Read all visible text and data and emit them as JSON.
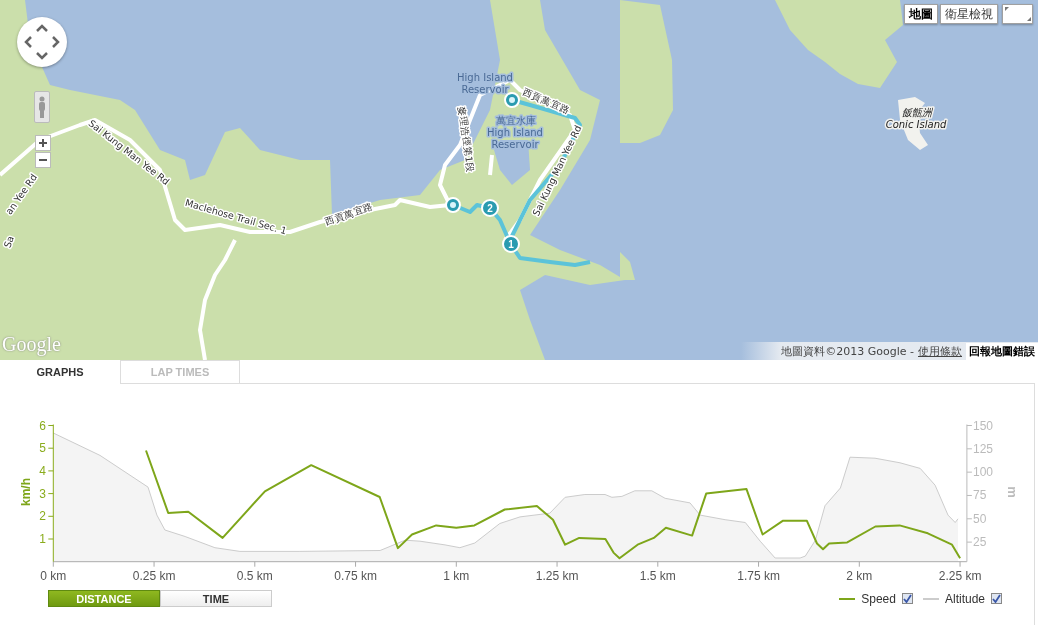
{
  "map": {
    "labels": [
      {
        "text": "High Island",
        "kind": "water"
      },
      {
        "text": "Reservoir",
        "kind": "water"
      },
      {
        "text": "萬宜水庫",
        "kind": "water"
      },
      {
        "text": "High Island",
        "kind": "water"
      },
      {
        "text": "Reservoir",
        "kind": "water"
      },
      {
        "text": "西貢萬宜路",
        "kind": "road"
      },
      {
        "text": "Sai Kung Man Yee Rd",
        "kind": "road"
      },
      {
        "text": "麥理浩徑第1段",
        "kind": "road"
      },
      {
        "text": "Sai Kung Man Yee Rd",
        "kind": "road"
      },
      {
        "text": "Maclehose Trail Sec. 1",
        "kind": "road"
      },
      {
        "text": "西貢萬宜路",
        "kind": "road"
      },
      {
        "text": "an Yee Rd",
        "kind": "road"
      },
      {
        "text": "Sa",
        "kind": "road"
      },
      {
        "text": "飯甑洲",
        "kind": "island"
      },
      {
        "text": "Conic Island",
        "kind": "island"
      }
    ],
    "markers": [
      {
        "kind": "dot"
      },
      {
        "kind": "dot"
      },
      {
        "kind": "number",
        "label": "2"
      },
      {
        "kind": "number",
        "label": "1"
      }
    ],
    "map_type_buttons": [
      {
        "label": "地圖",
        "selected": true
      },
      {
        "label": "衛星檢視",
        "selected": false
      }
    ],
    "logo": "Google",
    "attribution": {
      "text": "地圖資料©2013 Google -",
      "terms_link": "使用條款",
      "report_link": "回報地圖錯誤"
    }
  },
  "tabs": [
    {
      "label": "GRAPHS",
      "selected": true
    },
    {
      "label": "LAP TIMES",
      "selected": false
    }
  ],
  "chart_data": {
    "type": "line",
    "ylabel": "km/h",
    "y2label": "m",
    "xlim": [
      0,
      2.267
    ],
    "ylim": [
      0,
      6
    ],
    "y2lim": [
      4,
      150
    ],
    "xticks": [
      {
        "value": 0,
        "label": "0 km"
      },
      {
        "value": 0.25,
        "label": "0.25 km"
      },
      {
        "value": 0.5,
        "label": "0.5 km"
      },
      {
        "value": 0.75,
        "label": "0.75 km"
      },
      {
        "value": 1,
        "label": "1 km"
      },
      {
        "value": 1.25,
        "label": "1.25 km"
      },
      {
        "value": 1.5,
        "label": "1.5 km"
      },
      {
        "value": 1.75,
        "label": "1.75 km"
      },
      {
        "value": 2,
        "label": "2 km"
      },
      {
        "value": 2.25,
        "label": "2.25 km"
      }
    ],
    "yticks": [
      1,
      2,
      3,
      4,
      5,
      6
    ],
    "y2ticks": [
      25,
      50,
      75,
      100,
      125,
      150
    ],
    "series": [
      {
        "name": "Speed",
        "color": "#7ea61a",
        "x": [
          0.23,
          0.285,
          0.335,
          0.42,
          0.525,
          0.64,
          0.81,
          0.855,
          0.89,
          0.95,
          1.0,
          1.045,
          1.12,
          1.2,
          1.24,
          1.27,
          1.305,
          1.37,
          1.39,
          1.405,
          1.45,
          1.49,
          1.52,
          1.585,
          1.62,
          1.72,
          1.76,
          1.81,
          1.87,
          1.895,
          1.91,
          1.925,
          1.97,
          2.04,
          2.1,
          2.17,
          2.23,
          2.25
        ],
        "values": [
          4.9,
          2.15,
          2.2,
          1.05,
          3.1,
          4.25,
          2.85,
          0.6,
          1.2,
          1.6,
          1.5,
          1.6,
          2.3,
          2.45,
          1.85,
          0.75,
          1.05,
          1.0,
          0.4,
          0.15,
          0.75,
          1.05,
          1.5,
          1.15,
          3.0,
          3.2,
          1.2,
          1.8,
          1.8,
          0.8,
          0.55,
          0.8,
          0.85,
          1.55,
          1.6,
          1.25,
          0.75,
          0.15
        ]
      },
      {
        "name": "Altitude",
        "color": "#cccccc",
        "type": "area",
        "axis": "y2",
        "x": [
          0,
          0.116,
          0.235,
          0.257,
          0.277,
          0.327,
          0.401,
          0.463,
          0.612,
          0.811,
          0.873,
          0.91,
          0.972,
          1.009,
          1.046,
          1.108,
          1.158,
          1.232,
          1.27,
          1.319,
          1.369,
          1.386,
          1.411,
          1.443,
          1.485,
          1.518,
          1.58,
          1.605,
          1.667,
          1.717,
          1.754,
          1.791,
          1.853,
          1.866,
          1.891,
          1.915,
          1.953,
          1.977,
          2.039,
          2.101,
          2.151,
          2.188,
          2.22,
          2.238,
          2.245
        ],
        "values": [
          142,
          118,
          84,
          54,
          38,
          31,
          19,
          15,
          15,
          16,
          27,
          26,
          22,
          19,
          24,
          45,
          52,
          56,
          73,
          76,
          76,
          73,
          74,
          80,
          80,
          72,
          67,
          54,
          49,
          46,
          26,
          8,
          8,
          10,
          27,
          64,
          83,
          116,
          115,
          110,
          104,
          86,
          54,
          46,
          50
        ]
      }
    ]
  },
  "legend": [
    {
      "checked": true
    },
    {
      "checked": true
    }
  ],
  "axis_mode_buttons": [
    {
      "label": "DISTANCE",
      "selected": true
    },
    {
      "label": "TIME",
      "selected": false
    }
  ]
}
